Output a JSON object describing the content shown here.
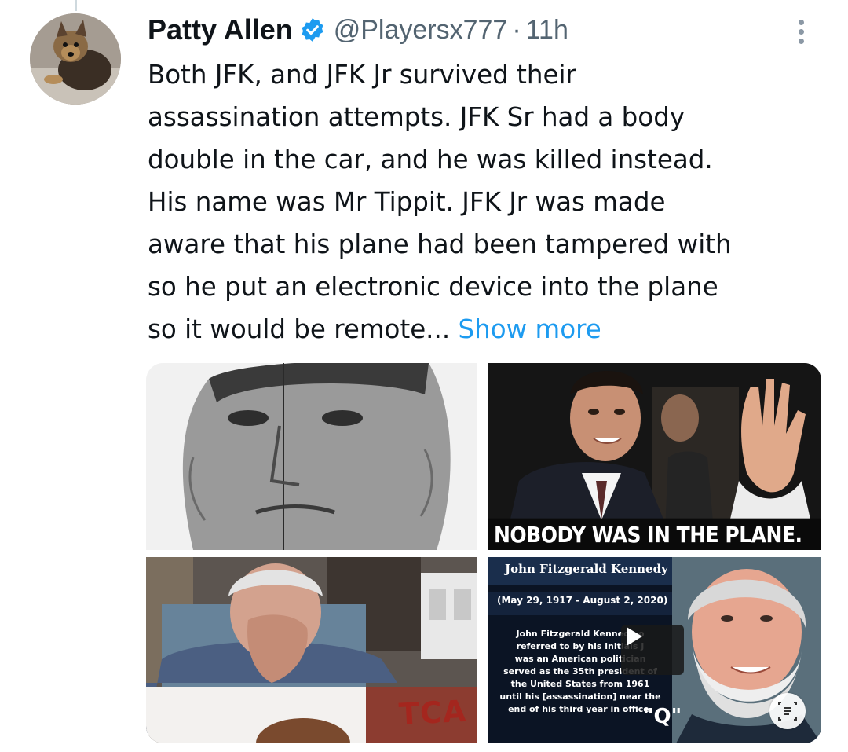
{
  "post": {
    "author_name": "Patty Allen",
    "author_handle": "@Playersx777",
    "separator": "·",
    "timestamp": "11h",
    "text_lines": [
      "Both JFK, and JFK Jr survived their",
      "assassination attempts. JFK Sr had a body",
      "double in the car, and he was killed instead.",
      "His name was Mr Tippit. JFK Jr was made",
      "aware that his plane had been tampered with",
      "so he put an electronic device into the plane",
      "so it would be remote..."
    ],
    "show_more_label": "Show more"
  },
  "media": {
    "image2_caption": "NOBODY WAS IN THE PLANE.",
    "image3_watermark": "TCA",
    "image4": {
      "title": "John Fitzgerald Kennedy",
      "dates": "(May 29, 1917 - August 2, 2020)",
      "body_lines": [
        "John Fitzgerald Kennedy o",
        "referred to by his initials J",
        "was an American politician",
        "served as the 35th president of",
        "the United States from 1961",
        "until his [assassination] near the",
        "end of his third year in office."
      ],
      "q_label": "\"Q\""
    }
  },
  "icons": {
    "verified": "verified-badge-icon",
    "more": "more-options-icon",
    "play": "play-icon",
    "alt_text": "alt-text-icon"
  },
  "colors": {
    "link": "#1d9bf0",
    "verified": "#1d9bf0",
    "secondary_text": "#536471",
    "primary_text": "#0f1419"
  }
}
